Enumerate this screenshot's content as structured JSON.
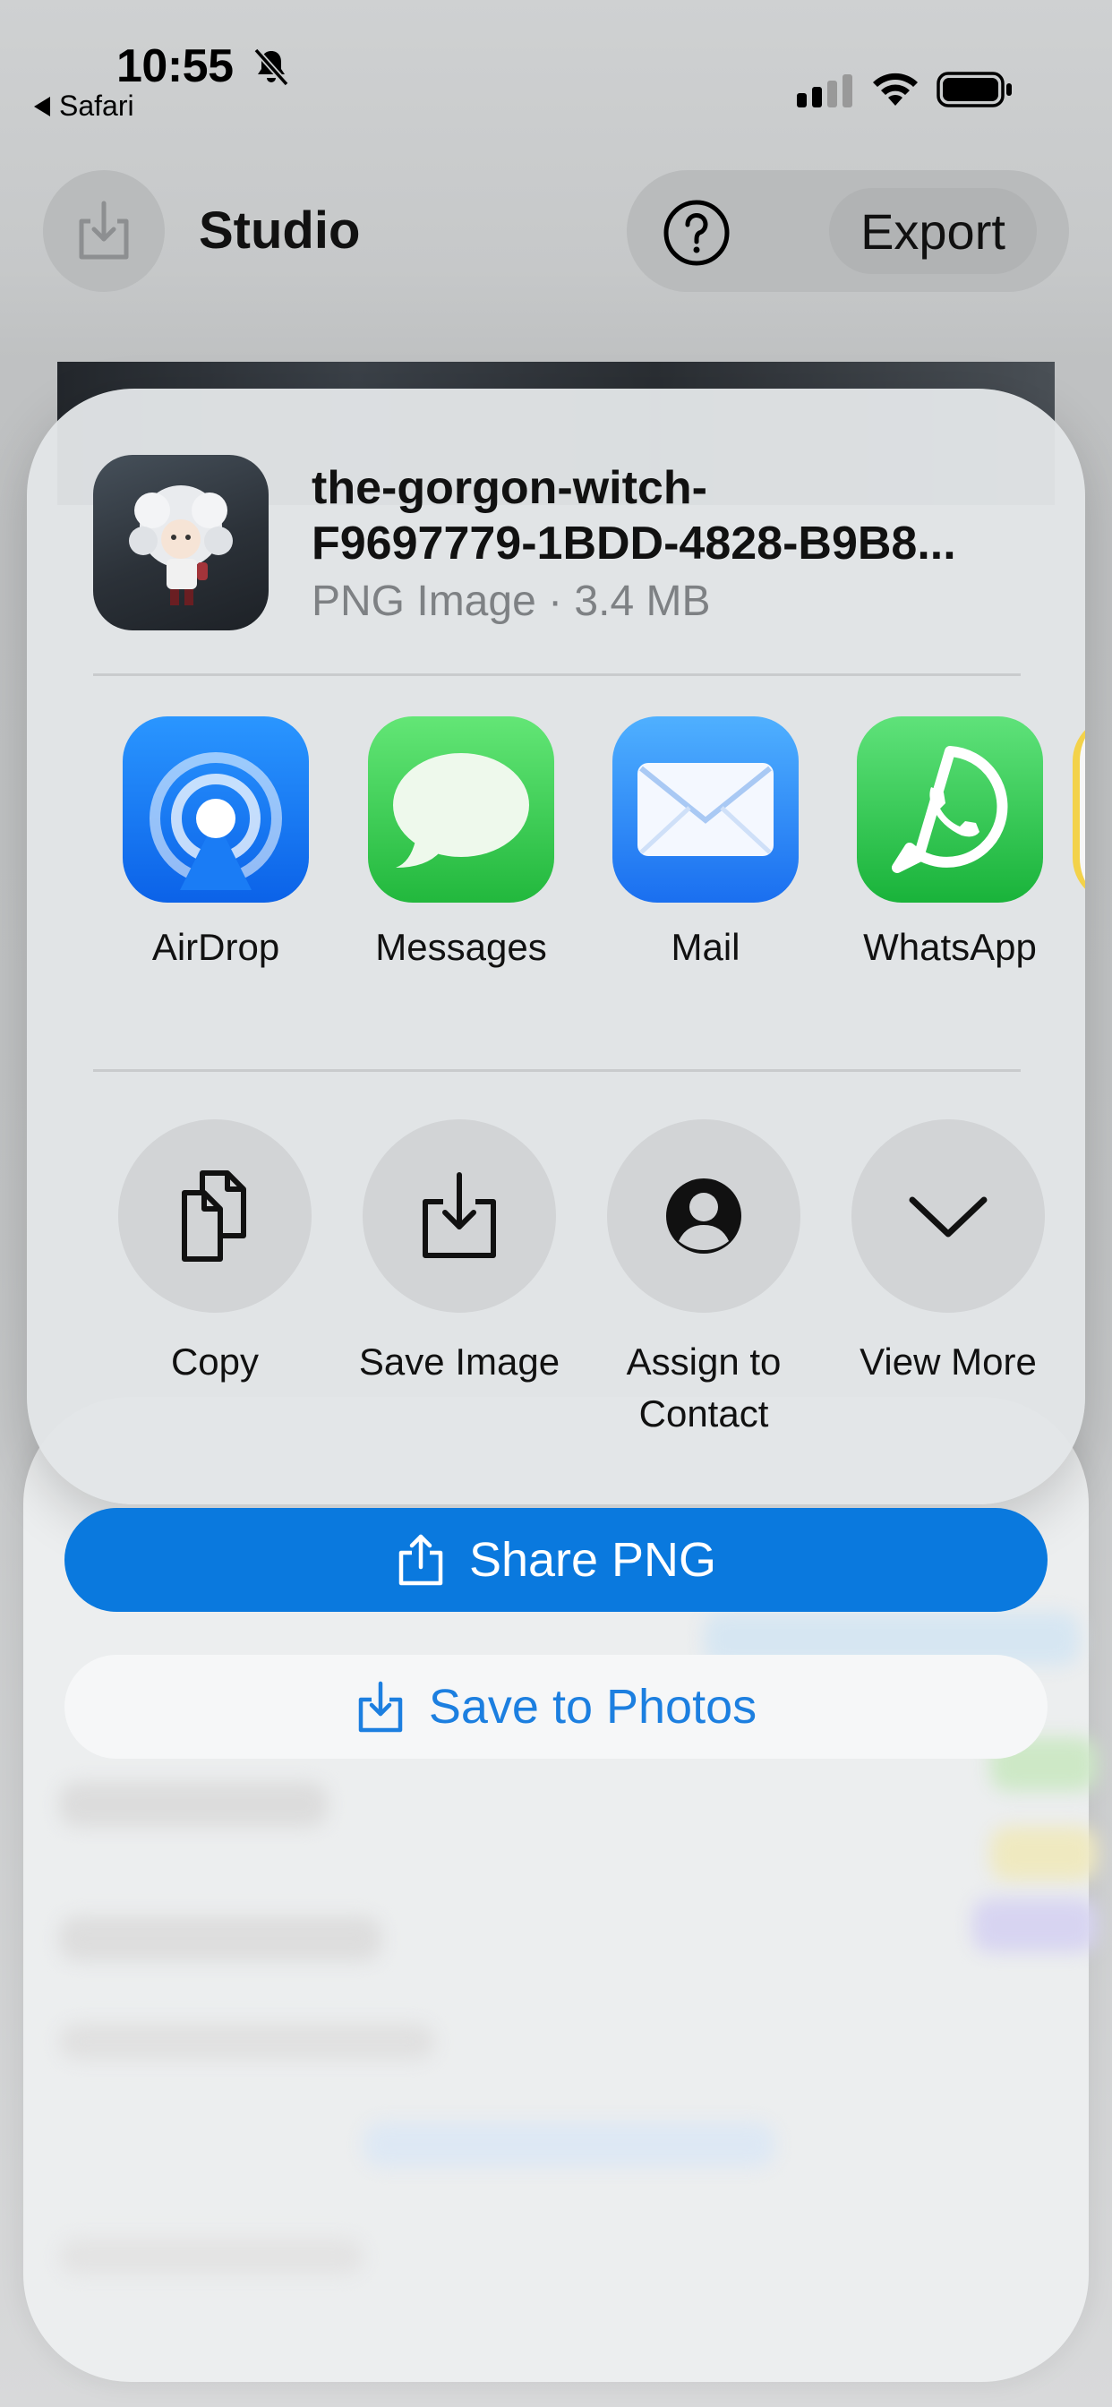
{
  "status_bar": {
    "time": "10:55",
    "back_app": "Safari"
  },
  "header": {
    "title": "Studio",
    "export_label": "Export"
  },
  "share_sheet": {
    "file_name": "the-gorgon-witch-\nF9697779-1BDD-4828-B9B8...",
    "file_meta": "PNG Image · 3.4 MB",
    "apps": [
      {
        "label": "AirDrop",
        "icon": "airdrop-icon",
        "color": "#1a7cf5"
      },
      {
        "label": "Messages",
        "icon": "messages-icon",
        "color": "#34c759"
      },
      {
        "label": "Mail",
        "icon": "mail-icon",
        "color": "#2f86f6"
      },
      {
        "label": "WhatsApp",
        "icon": "whatsapp-icon",
        "color": "#25d366"
      }
    ],
    "actions": [
      {
        "label": "Copy",
        "icon": "copy-icon"
      },
      {
        "label": "Save Image",
        "icon": "save-image-icon"
      },
      {
        "label": "Assign to\nContact",
        "icon": "contact-icon"
      },
      {
        "label": "View More",
        "icon": "chevron-down-icon"
      }
    ]
  },
  "buttons": {
    "share_png": "Share PNG",
    "save_to_photos": "Save to Photos"
  },
  "colors": {
    "accent": "#0a79de",
    "link": "#1c7fe0"
  }
}
